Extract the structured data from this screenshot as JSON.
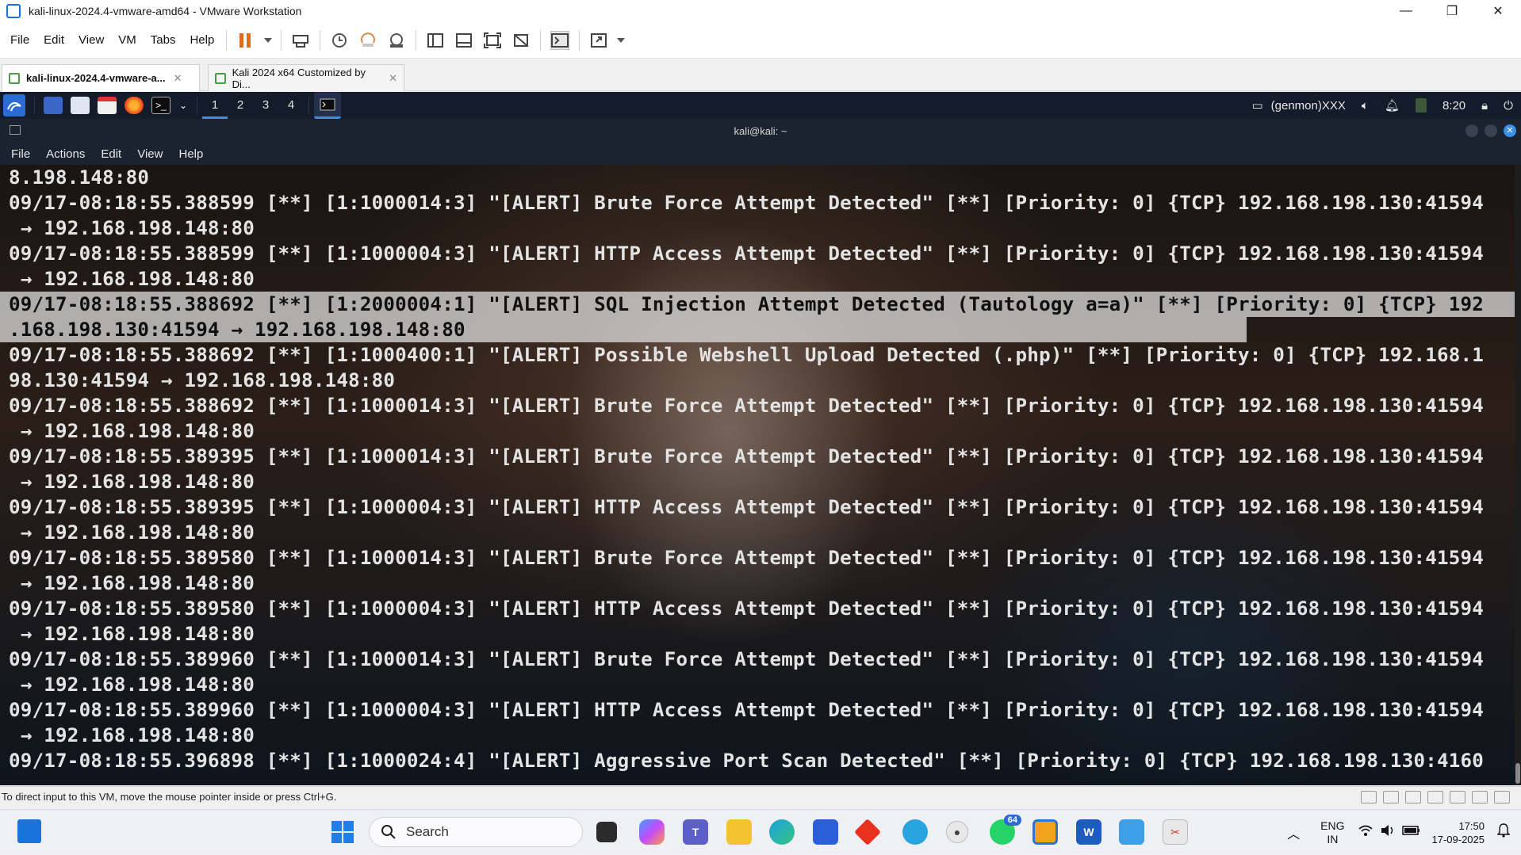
{
  "window": {
    "title": "kali-linux-2024.4-vmware-amd64 - VMware Workstation",
    "controls": [
      "—",
      "❐",
      "✕"
    ]
  },
  "menubar": {
    "items": [
      "File",
      "Edit",
      "View",
      "VM",
      "Tabs",
      "Help"
    ]
  },
  "tabs": [
    {
      "label": "kali-linux-2024.4-vmware-a...",
      "active": true
    },
    {
      "label": "Kali 2024 x64 Customized by Di...",
      "active": false
    }
  ],
  "guest_panel": {
    "workspaces": [
      "1",
      "2",
      "3",
      "4"
    ],
    "genmon": "(genmon)XXX",
    "time": "8:20"
  },
  "terminal": {
    "title": "kali@kali: ~",
    "menu": [
      "File",
      "Actions",
      "Edit",
      "View",
      "Help"
    ],
    "lines": [
      {
        "text": "8.198.148:80",
        "hl": false
      },
      {
        "text": "09/17-08:18:55.388599 [**] [1:1000014:3] \"[ALERT] Brute Force Attempt Detected\" [**] [Priority: 0] {TCP} 192.168.198.130:41594",
        "hl": false
      },
      {
        "text": " → 192.168.198.148:80",
        "hl": false
      },
      {
        "text": "09/17-08:18:55.388599 [**] [1:1000004:3] \"[ALERT] HTTP Access Attempt Detected\" [**] [Priority: 0] {TCP} 192.168.198.130:41594",
        "hl": false
      },
      {
        "text": " → 192.168.198.148:80",
        "hl": false
      },
      {
        "text": "09/17-08:18:55.388692 [**] [1:2000004:1] \"[ALERT] SQL Injection Attempt Detected (Tautology a=a)\" [**] [Priority: 0] {TCP} 192",
        "hl": true
      },
      {
        "text": ".168.198.130:41594 → 192.168.198.148:80",
        "hl": true
      },
      {
        "text": "09/17-08:18:55.388692 [**] [1:1000400:1] \"[ALERT] Possible Webshell Upload Detected (.php)\" [**] [Priority: 0] {TCP} 192.168.1",
        "hl": false
      },
      {
        "text": "98.130:41594 → 192.168.198.148:80",
        "hl": false
      },
      {
        "text": "09/17-08:18:55.388692 [**] [1:1000014:3] \"[ALERT] Brute Force Attempt Detected\" [**] [Priority: 0] {TCP} 192.168.198.130:41594",
        "hl": false
      },
      {
        "text": " → 192.168.198.148:80",
        "hl": false
      },
      {
        "text": "09/17-08:18:55.389395 [**] [1:1000014:3] \"[ALERT] Brute Force Attempt Detected\" [**] [Priority: 0] {TCP} 192.168.198.130:41594",
        "hl": false
      },
      {
        "text": " → 192.168.198.148:80",
        "hl": false
      },
      {
        "text": "09/17-08:18:55.389395 [**] [1:1000004:3] \"[ALERT] HTTP Access Attempt Detected\" [**] [Priority: 0] {TCP} 192.168.198.130:41594",
        "hl": false
      },
      {
        "text": " → 192.168.198.148:80",
        "hl": false
      },
      {
        "text": "09/17-08:18:55.389580 [**] [1:1000014:3] \"[ALERT] Brute Force Attempt Detected\" [**] [Priority: 0] {TCP} 192.168.198.130:41594",
        "hl": false
      },
      {
        "text": " → 192.168.198.148:80",
        "hl": false
      },
      {
        "text": "09/17-08:18:55.389580 [**] [1:1000004:3] \"[ALERT] HTTP Access Attempt Detected\" [**] [Priority: 0] {TCP} 192.168.198.130:41594",
        "hl": false
      },
      {
        "text": " → 192.168.198.148:80",
        "hl": false
      },
      {
        "text": "09/17-08:18:55.389960 [**] [1:1000014:3] \"[ALERT] Brute Force Attempt Detected\" [**] [Priority: 0] {TCP} 192.168.198.130:41594",
        "hl": false
      },
      {
        "text": " → 192.168.198.148:80",
        "hl": false
      },
      {
        "text": "09/17-08:18:55.389960 [**] [1:1000004:3] \"[ALERT] HTTP Access Attempt Detected\" [**] [Priority: 0] {TCP} 192.168.198.130:41594",
        "hl": false
      },
      {
        "text": " → 192.168.198.148:80",
        "hl": false
      },
      {
        "text": "09/17-08:18:55.396898 [**] [1:1000024:4] \"[ALERT] Aggressive Port Scan Detected\" [**] [Priority: 0] {TCP} 192.168.198.130:4160",
        "hl": false
      }
    ]
  },
  "statusbar": {
    "text": "To direct input to this VM, move the mouse pointer inside or press Ctrl+G."
  },
  "taskbar": {
    "search_label": "Search",
    "whatsapp_badge": "64",
    "lang_line1": "ENG",
    "lang_line2": "IN",
    "clock_time": "17:50",
    "clock_date": "17-09-2025"
  },
  "colors": {
    "terminal_bg": "#0c1118",
    "highlight_bg": "#d7d7d7",
    "kali_panel": "#141b2a",
    "accent": "#3b8fe6"
  }
}
